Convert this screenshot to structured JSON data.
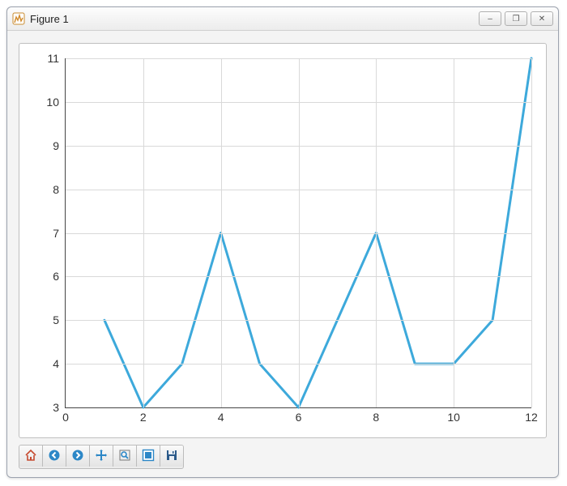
{
  "window": {
    "title": "Figure 1",
    "buttons": {
      "min": "–",
      "max": "❐",
      "close": "✕"
    }
  },
  "chart_data": {
    "type": "line",
    "x": [
      1,
      2,
      3,
      4,
      5,
      6,
      7,
      8,
      9,
      10,
      11,
      12
    ],
    "values": [
      5,
      3,
      4,
      7,
      4,
      3,
      5,
      7,
      4,
      4,
      5,
      11
    ],
    "xticks": [
      0,
      2,
      4,
      6,
      8,
      10,
      12
    ],
    "yticks": [
      3,
      4,
      5,
      6,
      7,
      8,
      9,
      10,
      11
    ],
    "xlim": [
      0,
      12
    ],
    "ylim": [
      3,
      11
    ],
    "grid": true,
    "color": "#3da9db",
    "title": "",
    "xlabel": "",
    "ylabel": ""
  },
  "toolbar": {
    "items": [
      {
        "name": "home",
        "title": "Home"
      },
      {
        "name": "back",
        "title": "Back"
      },
      {
        "name": "forward",
        "title": "Forward"
      },
      {
        "name": "pan",
        "title": "Pan"
      },
      {
        "name": "zoom",
        "title": "Zoom"
      },
      {
        "name": "subplots",
        "title": "Configure subplots"
      },
      {
        "name": "save",
        "title": "Save"
      }
    ]
  }
}
